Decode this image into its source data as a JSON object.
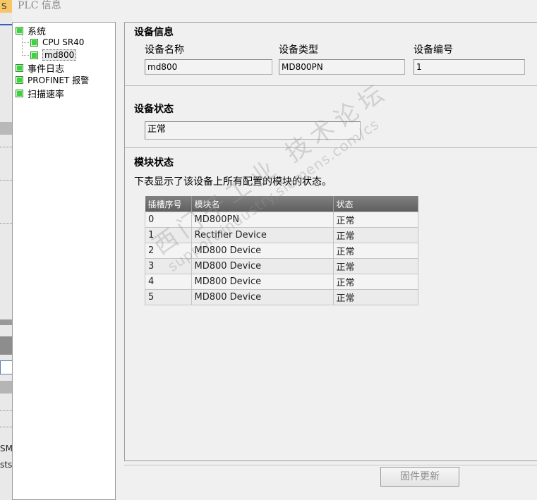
{
  "window": {
    "title": "PLC 信息"
  },
  "background": {
    "tab_letter": "S",
    "text1": "SMI",
    "text2": "sts"
  },
  "tree": {
    "system": "系统",
    "cpu": "CPU SR40",
    "device": "md800",
    "event_log": "事件日志",
    "profinet": "PROFINET 报警",
    "scan_rate": "扫描速率"
  },
  "device_info": {
    "heading": "设备信息",
    "name_label": "设备名称",
    "type_label": "设备类型",
    "number_label": "设备编号",
    "name_value": "md800",
    "type_value": "MD800PN",
    "number_value": "1"
  },
  "device_status": {
    "heading": "设备状态",
    "value": "正常"
  },
  "module_status": {
    "heading": "模块状态",
    "description": "下表显示了该设备上所有配置的模块的状态。",
    "columns": [
      "插槽序号",
      "模块名",
      "状态"
    ],
    "rows": [
      [
        "0",
        "MD800PN",
        "正常"
      ],
      [
        "1",
        "Rectifier Device",
        "正常"
      ],
      [
        "2",
        "MD800 Device",
        "正常"
      ],
      [
        "3",
        "MD800 Device",
        "正常"
      ],
      [
        "4",
        "MD800 Device",
        "正常"
      ],
      [
        "5",
        "MD800 Device",
        "正常"
      ]
    ]
  },
  "watermark": {
    "line1": "西门子工业 技术论坛",
    "line2": "support.industry.siemens.com/cs"
  },
  "actions": {
    "firmware_update": "固件更新"
  }
}
